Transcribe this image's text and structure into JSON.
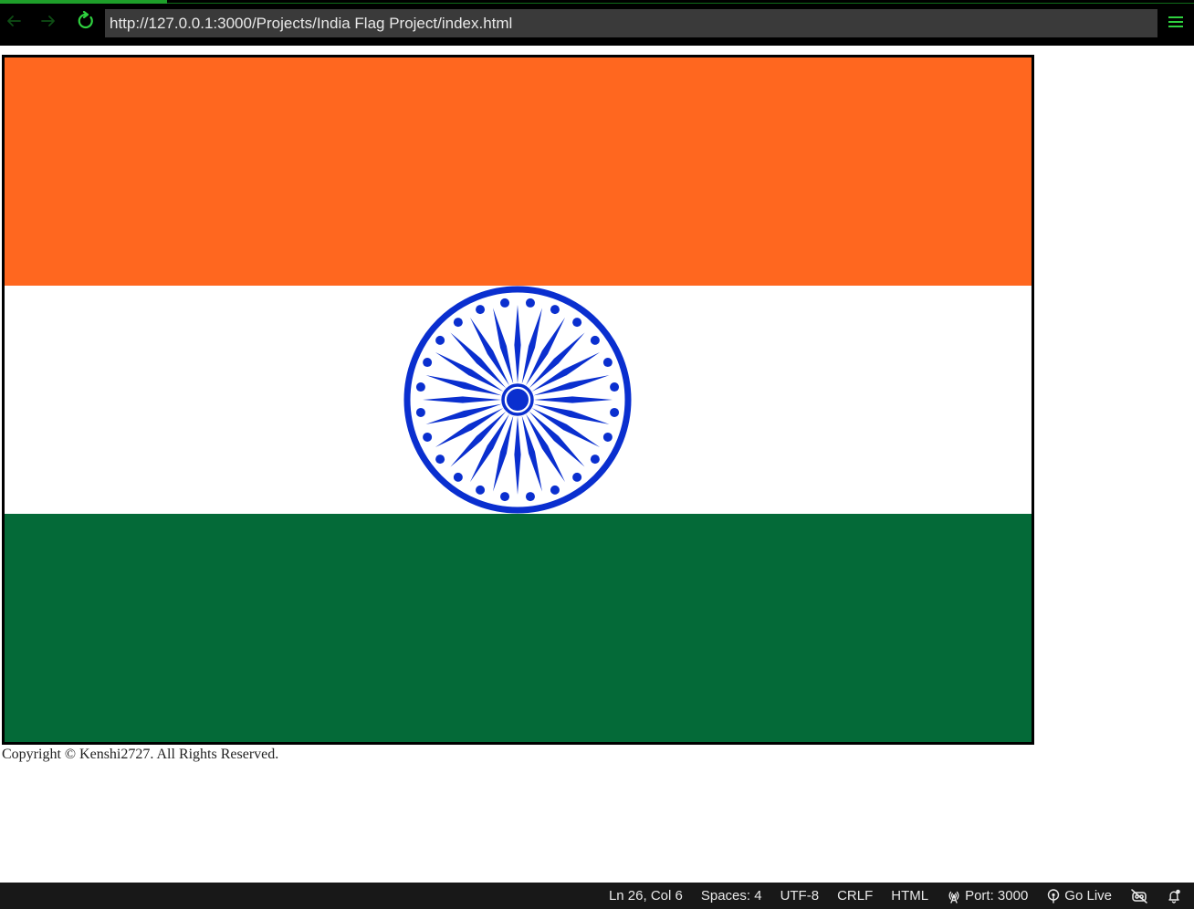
{
  "browser": {
    "url": "http://127.0.0.1:3000/Projects/India Flag Project/index.html",
    "load_progress": 0.14,
    "icons": {
      "back": "arrow-left-icon",
      "forward": "arrow-right-icon",
      "reload": "reload-icon",
      "menu": "hamburger-menu-icon"
    }
  },
  "flag": {
    "colors": {
      "saffron": "#ff671f",
      "white": "#ffffff",
      "green": "#046a38",
      "chakra": "#0a2fcf",
      "border": "#000000"
    },
    "spokes": 24
  },
  "footer": {
    "copyright": "Copyright © Kenshi2727. All Rights Reserved."
  },
  "statusbar": {
    "cursor": "Ln 26, Col 6",
    "indent": "Spaces: 4",
    "encoding": "UTF-8",
    "eol": "CRLF",
    "language": "HTML",
    "port": "Port: 3000",
    "go_live": "Go Live",
    "icons": {
      "port": "broadcast-icon",
      "go_live": "go-live-icon",
      "copilot": "copilot-disabled-icon",
      "notifications": "bell-icon"
    }
  }
}
